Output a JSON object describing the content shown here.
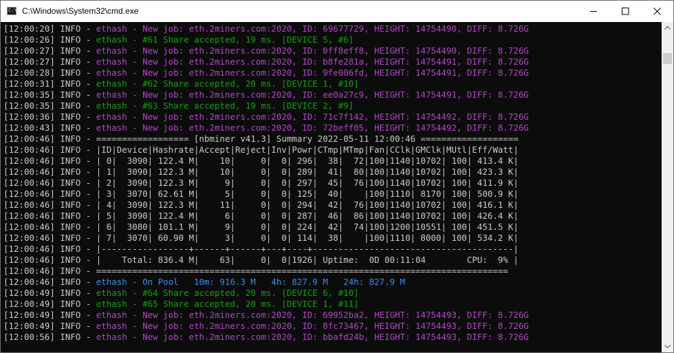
{
  "window": {
    "title": "C:\\Windows\\System32\\cmd.exe",
    "icon_text": "C:\\"
  },
  "colors": {
    "default": "#cccccc",
    "magenta": "#b148c6",
    "green": "#13a10e",
    "blue": "#3b8eea"
  },
  "console": {
    "lines": [
      [
        {
          "t": "[12:00:20] INFO - "
        },
        {
          "t": "ethash - New job: eth.2miners.com:2020, ID: 69677729, HEIGHT: 14754490, DIFF: 8.726G",
          "c": "magenta"
        }
      ],
      [
        {
          "t": "[12:00:26] INFO - "
        },
        {
          "t": "ethash - #61 Share accepted, 19 ms. [DEVICE 5, #6]",
          "c": "green"
        }
      ],
      [
        {
          "t": "[12:00:27] INFO - "
        },
        {
          "t": "ethash - New job: eth.2miners.com:2020, ID: 0ff8eff8, HEIGHT: 14754490, DIFF: 8.726G",
          "c": "magenta"
        }
      ],
      [
        {
          "t": "[12:00:27] INFO - "
        },
        {
          "t": "ethash - New job: eth.2miners.com:2020, ID: b8fe281a, HEIGHT: 14754491, DIFF: 8.726G",
          "c": "magenta"
        }
      ],
      [
        {
          "t": "[12:00:28] INFO - "
        },
        {
          "t": "ethash - New job: eth.2miners.com:2020, ID: 9fe006fd, HEIGHT: 14754491, DIFF: 8.726G",
          "c": "magenta"
        }
      ],
      [
        {
          "t": "[12:00:31] INFO - "
        },
        {
          "t": "ethash - #62 Share accepted, 20 ms. [DEVICE 1, #10]",
          "c": "green"
        }
      ],
      [
        {
          "t": "[12:00:35] INFO - "
        },
        {
          "t": "ethash - New job: eth.2miners.com:2020, ID: ee0a27c9, HEIGHT: 14754491, DIFF: 8.726G",
          "c": "magenta"
        }
      ],
      [
        {
          "t": "[12:00:35] INFO - "
        },
        {
          "t": "ethash - #63 Share accepted, 19 ms. [DEVICE 2, #9]",
          "c": "green"
        }
      ],
      [
        {
          "t": "[12:00:36] INFO - "
        },
        {
          "t": "ethash - New job: eth.2miners.com:2020, ID: 71c7f142, HEIGHT: 14754492, DIFF: 8.726G",
          "c": "magenta"
        }
      ],
      [
        {
          "t": "[12:00:43] INFO - "
        },
        {
          "t": "ethash - New job: eth.2miners.com:2020, ID: 72beff05, HEIGHT: 14754492, DIFF: 8.726G",
          "c": "magenta"
        }
      ],
      [
        {
          "t": "[12:00:46] INFO - ================== [nbminer v41.3] Summary 2022-05-11 12:00:46 ==================="
        }
      ],
      [
        {
          "t": "[12:00:46] INFO - |ID|Device|Hashrate|Accept|Reject|Inv|Powr|CTmp|MTmp|Fan|CClk|GMClk|MUtl|Eff/Watt|"
        }
      ],
      [
        {
          "t": "[12:00:46] INFO - | 0|  3090| 122.4 M|    10|     0|  0| 296|  38|  72|100|1140|10702| 100| 413.4 K|"
        }
      ],
      [
        {
          "t": "[12:00:46] INFO - | 1|  3090| 122.3 M|    10|     0|  0| 289|  41|  80|100|1140|10702| 100| 423.3 K|"
        }
      ],
      [
        {
          "t": "[12:00:46] INFO - | 2|  3090| 122.3 M|     9|     0|  0| 297|  45|  76|100|1140|10702| 100| 411.9 K|"
        }
      ],
      [
        {
          "t": "[12:00:46] INFO - | 3|  3070| 62.61 M|     5|     0|  0| 125|  40|    |100|1110| 8170| 100| 500.9 K|"
        }
      ],
      [
        {
          "t": "[12:00:46] INFO - | 4|  3090| 122.3 M|    11|     0|  0| 294|  42|  76|100|1140|10702| 100| 416.1 K|"
        }
      ],
      [
        {
          "t": "[12:00:46] INFO - | 5|  3090| 122.4 M|     6|     0|  0| 287|  46|  86|100|1140|10702| 100| 426.4 K|"
        }
      ],
      [
        {
          "t": "[12:00:46] INFO - | 6|  3080| 101.1 M|     9|     0|  0| 224|  42|  74|100|1200|10551| 100| 451.5 K|"
        }
      ],
      [
        {
          "t": "[12:00:46] INFO - | 7|  3070| 60.90 M|     3|     0|  0| 114|  38|    |100|1110| 8000| 100| 534.2 K|"
        }
      ],
      [
        {
          "t": "[12:00:46] INFO - |-----------------+------+------+---+----+---------------------------------------|"
        }
      ],
      [
        {
          "t": "[12:00:46] INFO - |    Total: 836.4 M|    63|     0|  0|1926| Uptime:  0D 00:11:04        CPU:  9% |"
        }
      ],
      [
        {
          "t": "[12:00:46] INFO - ================================================================================"
        }
      ],
      [
        {
          "t": "[12:00:46] INFO - "
        },
        {
          "t": "ethash - On Pool   10m: 916.3 M   4h: 827.9 M   24h: 827.9 M",
          "c": "blue"
        }
      ],
      [
        {
          "t": "[12:00:49] INFO - "
        },
        {
          "t": "ethash - #64 Share accepted, 20 ms. [DEVICE 6, #10]",
          "c": "green"
        }
      ],
      [
        {
          "t": "[12:00:49] INFO - "
        },
        {
          "t": "ethash - #65 Share accepted, 20 ms. [DEVICE 1, #11]",
          "c": "green"
        }
      ],
      [
        {
          "t": "[12:00:49] INFO - "
        },
        {
          "t": "ethash - New job: eth.2miners.com:2020, ID: 69952ba2, HEIGHT: 14754493, DIFF: 8.726G",
          "c": "magenta"
        }
      ],
      [
        {
          "t": "[12:00:49] INFO - "
        },
        {
          "t": "ethash - New job: eth.2miners.com:2020, ID: 8fc73467, HEIGHT: 14754493, DIFF: 8.726G",
          "c": "magenta"
        }
      ],
      [
        {
          "t": "[12:00:56] INFO - "
        },
        {
          "t": "ethash - New job: eth.2miners.com:2020, ID: bbafd24b, HEIGHT: 14754493, DIFF: 8.726G",
          "c": "magenta"
        }
      ]
    ]
  }
}
